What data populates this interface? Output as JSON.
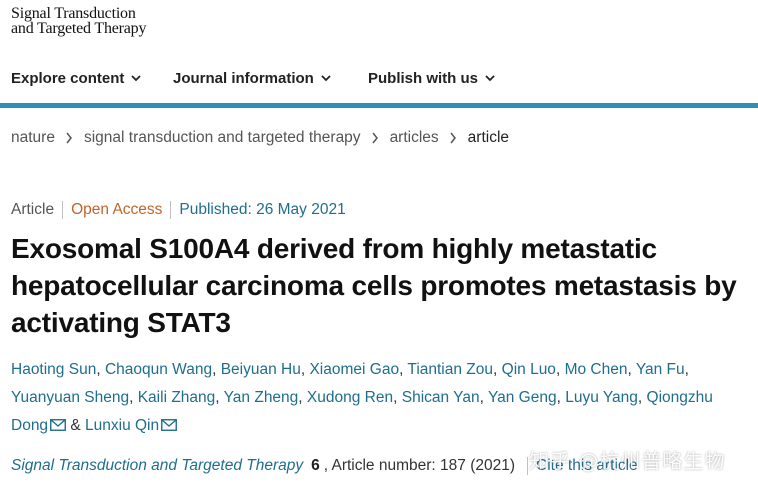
{
  "header": {
    "logo_line1": "Signal Transduction",
    "logo_line2": "and Targeted Therapy"
  },
  "nav": {
    "items": [
      {
        "label": "Explore content"
      },
      {
        "label": "Journal information"
      },
      {
        "label": "Publish with us"
      }
    ],
    "accent_color": "#2d90b0"
  },
  "breadcrumb": {
    "items": [
      {
        "label": "nature"
      },
      {
        "label": "signal transduction and targeted therapy"
      },
      {
        "label": "articles"
      },
      {
        "label": "article"
      }
    ]
  },
  "article": {
    "type": "Article",
    "access": "Open Access",
    "published": "Published: 26 May 2021",
    "title": "Exosomal S100A4 derived from highly metastatic hepatocellular carcinoma cells promotes metastasis by activating STAT3",
    "authors": [
      "Haoting Sun",
      "Chaoqun Wang",
      "Beiyuan Hu",
      "Xiaomei Gao",
      "Tiantian Zou",
      "Qin Luo",
      "Mo Chen",
      "Yan Fu",
      "Yuanyuan Sheng",
      "Kaili Zhang",
      "Yan Zheng",
      "Xudong Ren",
      "Shican Yan",
      "Yan Geng",
      "Luyu Yang",
      "Qiongzhu Dong",
      "Lunxiu Qin"
    ],
    "ampersand": "&",
    "citation": {
      "journal": "Signal Transduction and Targeted Therapy",
      "volume": "6",
      "article_number": ", Article number: 187 (2021)",
      "cite_label": "Cite this article"
    }
  },
  "watermark": "知乎 @杭州普略生物",
  "colors": {
    "link": "#1f6e8c",
    "open_access": "#c0642a",
    "title": "#111111"
  }
}
